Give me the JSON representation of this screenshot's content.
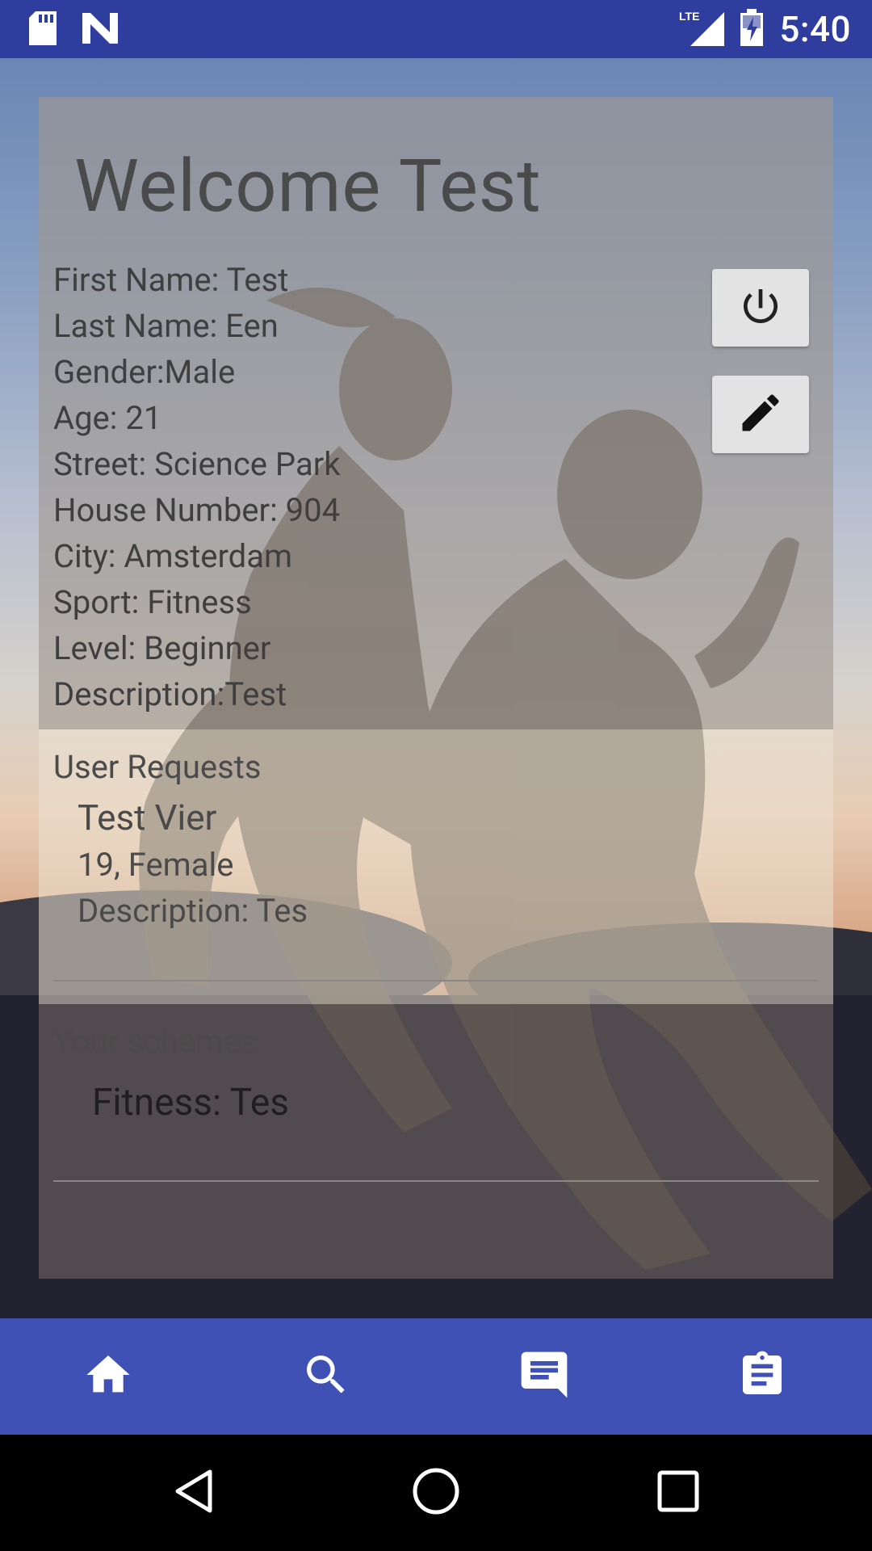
{
  "status_bar": {
    "time": "5:40",
    "network": "LTE",
    "icons": [
      "sd-card-icon",
      "n-logo-icon",
      "lte-signal-icon",
      "battery-charging-icon"
    ]
  },
  "profile": {
    "welcome": "Welcome Test",
    "fields": [
      "First Name: Test",
      "Last Name: Een",
      "Gender:Male",
      "Age: 21",
      "Street: Science Park",
      "House Number: 904",
      "City: Amsterdam",
      "Sport: Fitness",
      "Level: Beginner",
      "Description:Test"
    ]
  },
  "actions": {
    "icons": [
      "power-icon",
      "edit-pencil-icon"
    ]
  },
  "requests": {
    "title": "User Requests",
    "items": [
      {
        "name": "Test Vier",
        "age_gender": "19, Female",
        "description": "Description: Tes"
      }
    ]
  },
  "schemes": {
    "title": "Your schemes",
    "items": [
      "Fitness: Tes"
    ]
  },
  "bottom_nav": {
    "items": [
      "home-icon",
      "search-icon",
      "chat-icon",
      "assignment-icon"
    ]
  },
  "system_nav": {
    "items": [
      "back-icon",
      "home-circle-icon",
      "recents-icon"
    ]
  },
  "colors": {
    "primary": "#3f51b5",
    "status_bar": "#2f3e9e"
  }
}
